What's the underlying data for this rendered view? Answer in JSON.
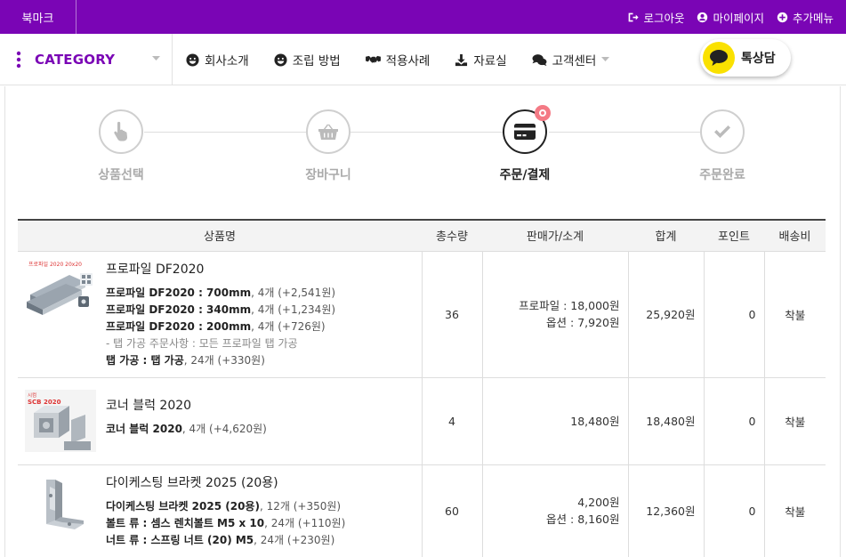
{
  "topbar": {
    "bookmark": "북마크",
    "links": [
      {
        "icon": "logout-icon",
        "label": "로그아웃"
      },
      {
        "icon": "user-icon",
        "label": "마이페이지"
      },
      {
        "icon": "plus-circle-icon",
        "label": "추가메뉴"
      }
    ]
  },
  "nav": {
    "category": "CATEGORY",
    "items": [
      {
        "icon": "smile-icon",
        "label": "회사소개"
      },
      {
        "icon": "smile-icon",
        "label": "조립 방법"
      },
      {
        "icon": "handshake-icon",
        "label": "적용사례"
      },
      {
        "icon": "download-icon",
        "label": "자료실"
      },
      {
        "icon": "chat-icon",
        "label": "고객센터"
      }
    ],
    "talk_label": "톡상담"
  },
  "steps": [
    {
      "icon": "pointer-hand-icon",
      "label": "상품선택",
      "active": false
    },
    {
      "icon": "basket-icon",
      "label": "장바구니",
      "active": false
    },
    {
      "icon": "card-icon",
      "label": "주문/결제",
      "active": true
    },
    {
      "icon": "check-icon",
      "label": "주문완료",
      "active": false
    }
  ],
  "table": {
    "headers": [
      "상품명",
      "총수량",
      "판매가/소계",
      "합계",
      "포인트",
      "배송비"
    ],
    "rows": [
      {
        "name": "프로파일 DF2020",
        "thumb_caption": "프로파일 2020 20x20",
        "options": [
          {
            "b": "프로파일 DF2020 : 700mm",
            "n": ", 4개 (+2,541원)"
          },
          {
            "b": "프로파일 DF2020 : 340mm",
            "n": ", 4개 (+1,234원)"
          },
          {
            "b": "프로파일 DF2020 : 200mm",
            "n": ", 4개 (+726원)"
          },
          {
            "g": "- 탭 가공 주문사항 : 모든 프로파일 탭 가공"
          },
          {
            "b": "탭 가공 : 탭 가공",
            "n": ", 24개 (+330원)"
          }
        ],
        "qty": "36",
        "price_lines": [
          "프로파일 : 18,000원",
          "옵션 : 7,920원"
        ],
        "total": "25,920원",
        "point": "0",
        "shipping": "착불"
      },
      {
        "name": "코너 블럭 2020",
        "thumb_caption": "SCB 2020",
        "options": [
          {
            "b": "코너 블럭 2020",
            "n": ", 4개 (+4,620원)"
          }
        ],
        "qty": "4",
        "price_lines": [
          "18,480원"
        ],
        "total": "18,480원",
        "point": "0",
        "shipping": "착불"
      },
      {
        "name": "다이케스팅 브라켓 2025 (20용)",
        "thumb_caption": "",
        "options": [
          {
            "b": "다이케스팅 브라켓 2025 (20용)",
            "n": ", 12개 (+350원)"
          },
          {
            "b": "볼트 류 : 셈스 렌치볼트 M5 x 10",
            "n": ", 24개 (+110원)"
          },
          {
            "b": "너트 류 : 스프링 너트 (20) M5",
            "n": ", 24개 (+230원)"
          }
        ],
        "qty": "60",
        "price_lines": [
          "4,200원",
          "옵션 : 8,160원"
        ],
        "total": "12,360원",
        "point": "0",
        "shipping": "착불"
      }
    ]
  },
  "colors": {
    "brand": "#7a05b5",
    "kakao": "#fae100",
    "notify": "#f47a85"
  }
}
